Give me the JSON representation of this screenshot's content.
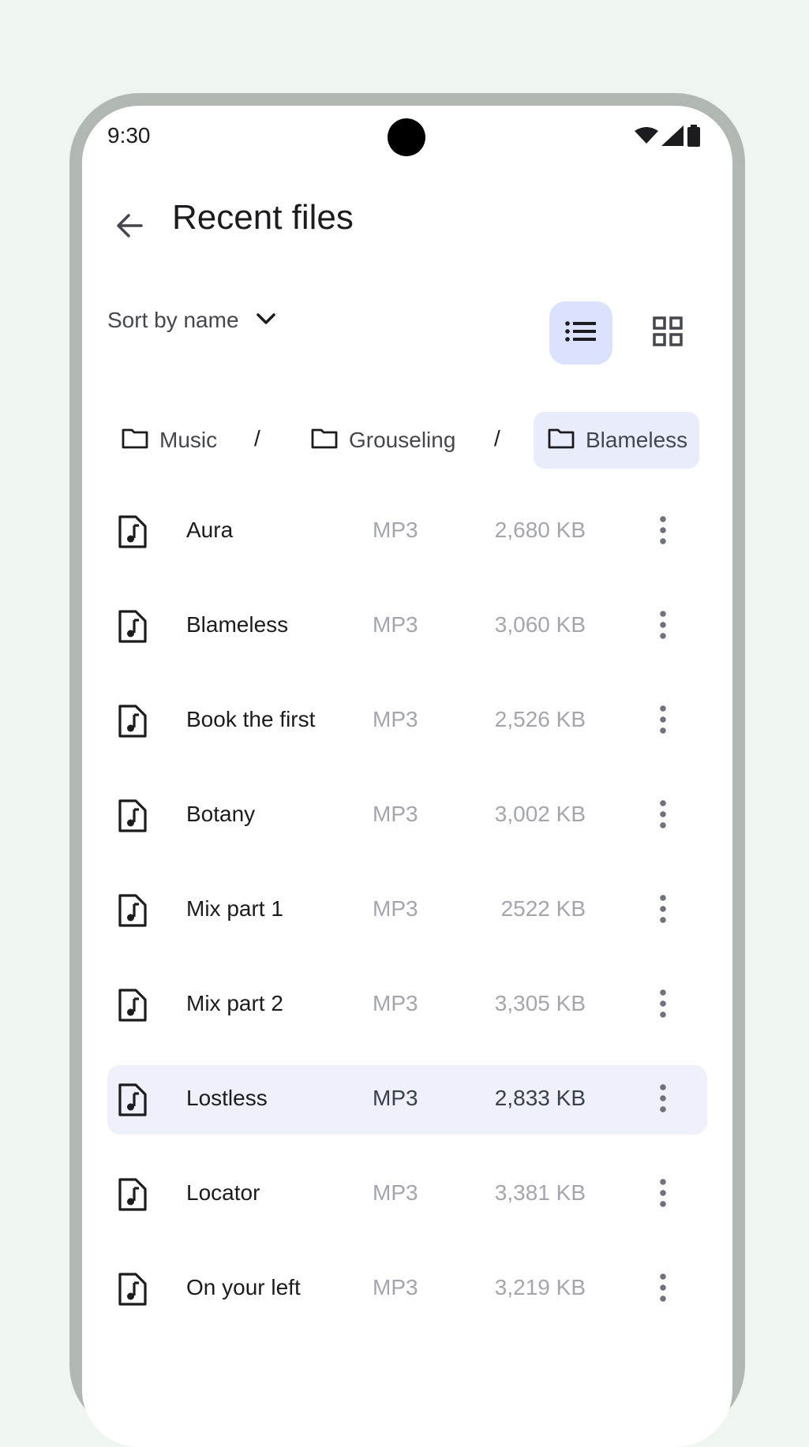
{
  "status_bar": {
    "time": "9:30",
    "icons": [
      "wifi-icon",
      "cellular-signal-icon",
      "battery-icon"
    ]
  },
  "app_bar": {
    "back_icon": "arrow-back-icon",
    "title": "Recent files"
  },
  "sort": {
    "label": "Sort by name",
    "icon": "chevron-down-icon"
  },
  "view_toggle": {
    "selected": "list",
    "options": [
      "list",
      "grid"
    ]
  },
  "breadcrumb": {
    "separator": "/",
    "items": [
      {
        "label": "Music",
        "active": false
      },
      {
        "label": "Grouseling",
        "active": false
      },
      {
        "label": "Blameless",
        "active": true
      }
    ]
  },
  "files": [
    {
      "name": "Aura",
      "type": "MP3",
      "size": "2,680 KB",
      "selected": false
    },
    {
      "name": "Blameless",
      "type": "MP3",
      "size": "3,060 KB",
      "selected": false
    },
    {
      "name": "Book the first",
      "type": "MP3",
      "size": "2,526 KB",
      "selected": false
    },
    {
      "name": "Botany",
      "type": "MP3",
      "size": "3,002 KB",
      "selected": false
    },
    {
      "name": "Mix part 1",
      "type": "MP3",
      "size": "2522 KB",
      "selected": false
    },
    {
      "name": "Mix part 2",
      "type": "MP3",
      "size": "3,305 KB",
      "selected": false
    },
    {
      "name": "Lostless",
      "type": "MP3",
      "size": "2,833 KB",
      "selected": true
    },
    {
      "name": "Locator",
      "type": "MP3",
      "size": "3,381 KB",
      "selected": false
    },
    {
      "name": "On your left",
      "type": "MP3",
      "size": "3,219 KB",
      "selected": false
    }
  ],
  "colors": {
    "background": "#eff5ef",
    "device_frame": "#b1b8b1",
    "view_selected": "#dbe2fd",
    "crumb_active": "#e8ecfb",
    "row_selected": "#eef0fa"
  }
}
